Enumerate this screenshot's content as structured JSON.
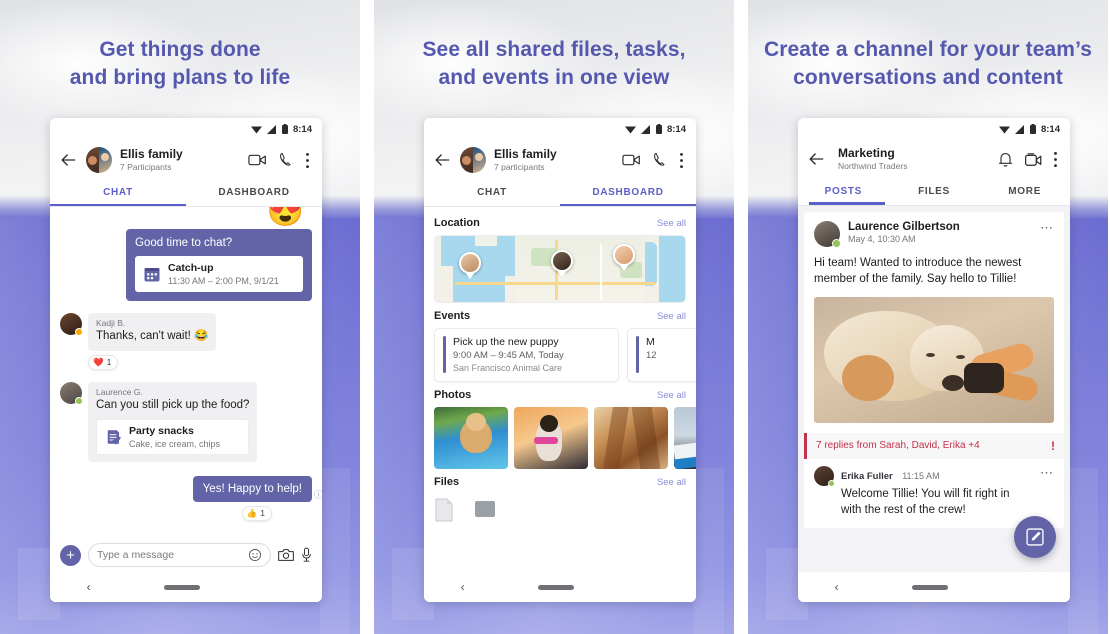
{
  "panels": [
    {
      "headline_line1": "Get things done",
      "headline_line2": "and bring plans to life",
      "status": {
        "time": "8:14"
      },
      "header": {
        "title": "Ellis family",
        "subtitle": "7 Participants",
        "back_icon": "back-arrow-icon",
        "video_icon": "video-call-icon",
        "call_icon": "phone-call-icon",
        "more_icon": "overflow-menu-icon"
      },
      "tabs": [
        {
          "label": "CHAT",
          "active": true
        },
        {
          "label": "DASHBOARD",
          "active": false
        }
      ],
      "chat": {
        "floating_emoji": "😍",
        "outgoing_1": {
          "text": "Good time to chat?",
          "card_title": "Catch-up",
          "card_sub": "11:30 AM – 2:00 PM, 9/1/21",
          "card_icon": "calendar-icon"
        },
        "incoming_1": {
          "sender": "Kadji B.",
          "text": "Thanks, can't wait! 😂",
          "reaction_emoji": "❤️",
          "reaction_count": "1"
        },
        "incoming_2": {
          "sender": "Laurence G.",
          "text": "Can you still pick up the food?",
          "card_title": "Party snacks",
          "card_sub": "Cake, ice cream, chips",
          "card_icon": "task-list-icon"
        },
        "outgoing_2": {
          "text": "Yes! Happy to help!",
          "reaction_emoji": "👍",
          "reaction_count": "1"
        }
      },
      "composer": {
        "add_label": "+",
        "placeholder": "Type a message",
        "emoji_icon": "emoji-icon",
        "camera_icon": "camera-icon",
        "mic_icon": "microphone-icon"
      },
      "navbar": {
        "back": "‹",
        "home_pill": "home-pill"
      }
    },
    {
      "headline_line1": "See all shared files, tasks,",
      "headline_line2": "and events in one view",
      "status": {
        "time": "8:14"
      },
      "header": {
        "title": "Ellis family",
        "subtitle": "7 participants",
        "back_icon": "back-arrow-icon",
        "video_icon": "video-call-icon",
        "call_icon": "phone-call-icon",
        "more_icon": "overflow-menu-icon"
      },
      "tabs": [
        {
          "label": "CHAT",
          "active": false
        },
        {
          "label": "DASHBOARD",
          "active": true
        }
      ],
      "dashboard": {
        "sections": [
          {
            "title": "Location",
            "see_all": "See all"
          },
          {
            "title": "Events",
            "see_all": "See all"
          },
          {
            "title": "Photos",
            "see_all": "See all"
          },
          {
            "title": "Files",
            "see_all": "See all"
          }
        ],
        "events": [
          {
            "title": "Pick up the new puppy",
            "time": "9:00 AM – 9:45 AM, Today",
            "location": "San Francisco Animal Care"
          },
          {
            "title": "M",
            "time": "12",
            "location": ""
          }
        ],
        "map_label": "bellevue-map",
        "photos": [
          "dog-in-pool-photo",
          "child-photo",
          "slot-canyon-photo",
          "surfing-photo"
        ]
      }
    },
    {
      "headline_line1": "Create a channel for your team’s",
      "headline_line2": "conversations and content",
      "status": {
        "time": "8:14"
      },
      "header": {
        "title": "Marketing",
        "subtitle": "Northwind Traders",
        "back_icon": "back-arrow-icon",
        "bell_icon": "notification-bell-icon",
        "video_icon": "video-call-icon",
        "more_icon": "overflow-menu-icon"
      },
      "tabs": [
        {
          "label": "POSTS",
          "active": true
        },
        {
          "label": "FILES",
          "active": false
        },
        {
          "label": "MORE",
          "active": false
        }
      ],
      "post": {
        "author": "Laurence Gilbertson",
        "timestamp": "May 4, 10:30 AM",
        "body": "Hi team! Wanted to introduce the newest member of the family. Say hello to Tillie!",
        "image_label": "puppy-with-toy-photo",
        "replies_summary": "7 replies from Sarah, David, Erika +4",
        "urgent_marker": "!",
        "reply": {
          "author": "Erika Fuller",
          "timestamp": "11:15 AM",
          "body": "Welcome Tillie! You will fit right in with the rest of the crew!"
        }
      },
      "fab": {
        "icon": "compose-icon"
      },
      "navbar": {
        "back": "‹",
        "home_pill": "home-pill"
      }
    }
  ],
  "colors": {
    "brand_purple": "#6264a7",
    "headline_purple": "#5558af",
    "link_purple": "#8a8dd6",
    "urgent_red": "#c4314b",
    "presence_green": "#92c353",
    "presence_amber": "#f8a800"
  }
}
